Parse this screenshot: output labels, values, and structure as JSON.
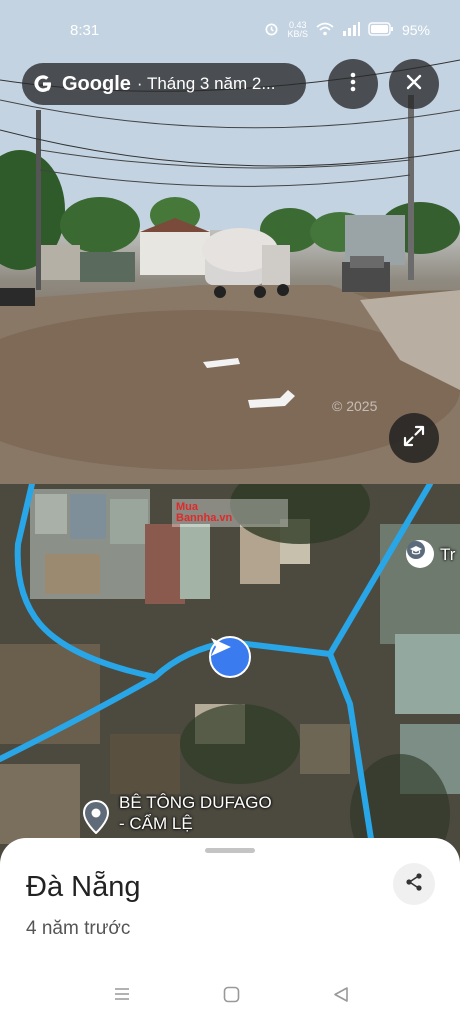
{
  "status": {
    "time": "8:31",
    "net_speed_value": "0.43",
    "net_speed_unit": "KB/S",
    "battery": "95%"
  },
  "header": {
    "brand": "Google",
    "subtitle": "· Tháng 3 năm 2..."
  },
  "streetview": {
    "copyright": "© 2025"
  },
  "map": {
    "poi_label_line1": "BÊ TÔNG DUFAGO",
    "poi_label_line2": "- CẨM LỆ",
    "school_label": "Tr",
    "watermark_line1": "Mua",
    "watermark_line2": "Bannha.vn"
  },
  "sheet": {
    "title": "Đà Nẵng",
    "subtitle": "4 năm trước"
  },
  "colors": {
    "road": "#29a6e8",
    "nav": "#3a7bf0"
  }
}
